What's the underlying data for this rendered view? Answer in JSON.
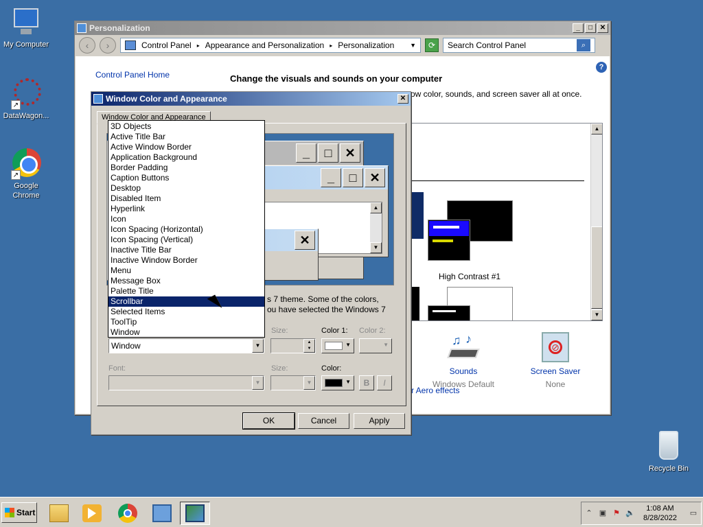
{
  "desktop": {
    "icons": [
      {
        "label": "My Computer"
      },
      {
        "label": "DataWagon..."
      },
      {
        "label": "Google Chrome"
      },
      {
        "label": "Recycle Bin"
      }
    ]
  },
  "personalization": {
    "title": "Personalization",
    "breadcrumb": [
      "Control Panel",
      "Appearance and Personalization",
      "Personalization"
    ],
    "search_placeholder": "Search Control Panel",
    "sidebar_link": "Control Panel Home",
    "heading": "Change the visuals and sounds on your computer",
    "subheading": "ow color, sounds, and screen saver all at once.",
    "theme_label": "High Contrast #1",
    "sounds": {
      "label": "Sounds",
      "value": "Windows Default"
    },
    "screensaver": {
      "label": "Screen Saver",
      "value": "None"
    },
    "aero_link": "r Aero effects",
    "help": "?"
  },
  "dialog": {
    "title": "Window Color and Appearance",
    "tab": "Window Color and Appearance",
    "desc_line1": "s 7 theme.  Some of the colors,",
    "desc_line2": "ou have selected the Windows 7",
    "item_value": "Window",
    "size_label": "Size:",
    "color1_label": "Color 1:",
    "color2_label": "Color 2:",
    "font_label": "Font:",
    "font_size_label": "Size:",
    "color_label": "Color:",
    "bold": "B",
    "italic": "I",
    "buttons": {
      "ok": "OK",
      "cancel": "Cancel",
      "apply": "Apply"
    },
    "dropdown_items": [
      "3D Objects",
      "Active Title Bar",
      "Active Window Border",
      "Application Background",
      "Border Padding",
      "Caption Buttons",
      "Desktop",
      "Disabled Item",
      "Hyperlink",
      "Icon",
      "Icon Spacing (Horizontal)",
      "Icon Spacing (Vertical)",
      "Inactive Title Bar",
      "Inactive Window Border",
      "Menu",
      "Message Box",
      "Palette Title",
      "Scrollbar",
      "Selected Items",
      "ToolTip",
      "Window"
    ],
    "selected_item": "Scrollbar",
    "color1_swatch": "#ffffff",
    "font_color_swatch": "#000000"
  },
  "taskbar": {
    "start": "Start",
    "time": "1:08 AM",
    "date": "8/28/2022"
  },
  "colors": {
    "desktop": "#3a6ea5",
    "selection": "#0a246a"
  }
}
